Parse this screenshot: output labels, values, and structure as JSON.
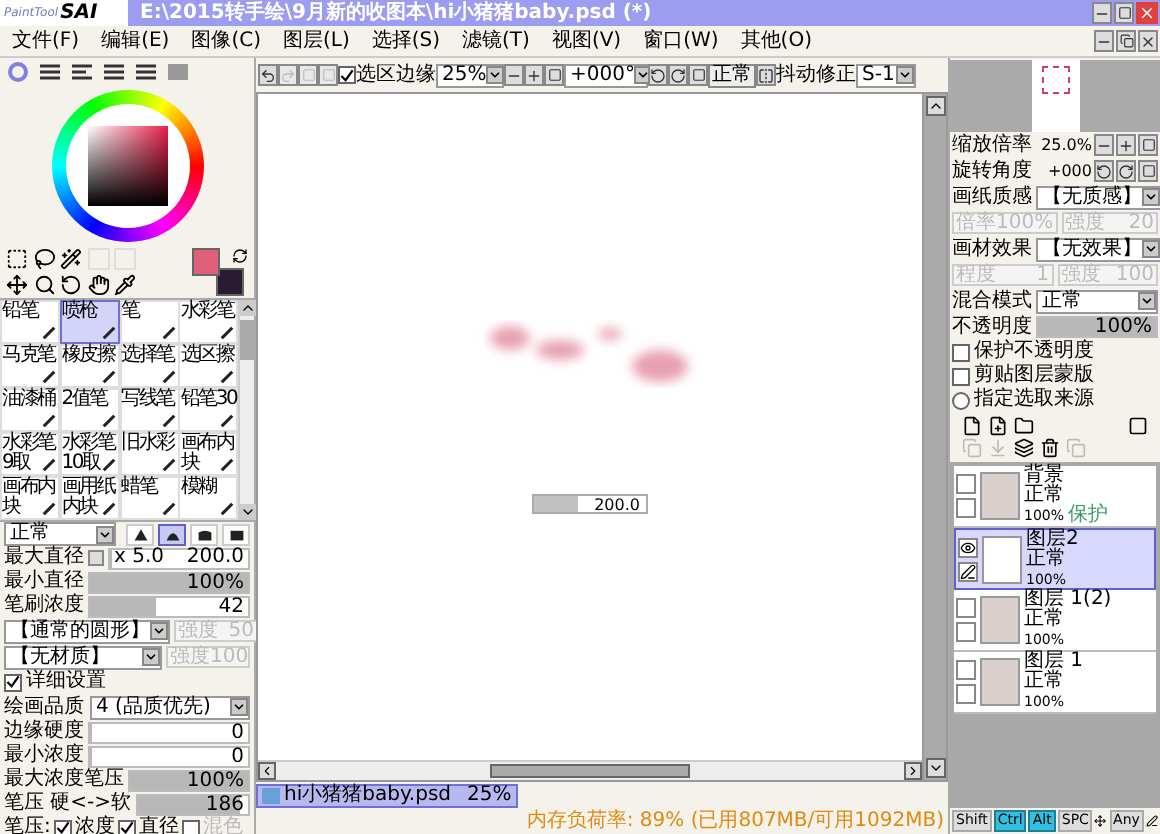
{
  "window": {
    "logo_small": "PaintTool",
    "logo_big": "SAI",
    "title": "E:\\2015转手绘\\9月新的收图本\\hi小猪猪baby.psd (*)"
  },
  "menu": [
    "文件(F)",
    "编辑(E)",
    "图像(C)",
    "图层(L)",
    "选择(S)",
    "滤镜(T)",
    "视图(V)",
    "窗口(W)",
    "其他(O)"
  ],
  "toolbar": {
    "selection_edge": {
      "label": "选区边缘",
      "checked": true
    },
    "zoom": "25%",
    "rotation": "+000°",
    "mode": "正常",
    "stabilizer_label": "抖动修正",
    "stabilizer": "S-1"
  },
  "color_panel": {
    "swatches": [
      {
        "color": "#e0607a"
      },
      {
        "color": "#2a1b35"
      }
    ]
  },
  "tools": [
    {
      "label": "铅笔",
      "selected": false
    },
    {
      "label": "喷枪",
      "selected": true
    },
    {
      "label": "笔",
      "selected": false
    },
    {
      "label": "水彩笔",
      "selected": false
    },
    {
      "label": "马克笔",
      "selected": false
    },
    {
      "label": "橡皮擦",
      "selected": false
    },
    {
      "label": "选择笔",
      "selected": false
    },
    {
      "label": "选区擦",
      "selected": false
    },
    {
      "label": "油漆桶",
      "selected": false
    },
    {
      "label": "2值笔",
      "selected": false
    },
    {
      "label": "写线笔",
      "selected": false
    },
    {
      "label": "铅笔30",
      "selected": false
    },
    {
      "label": "水彩笔9取",
      "selected": false
    },
    {
      "label": "水彩笔10取",
      "selected": false
    },
    {
      "label": "旧水彩",
      "selected": false
    },
    {
      "label": "画布内块",
      "selected": false
    },
    {
      "label": "画布内块",
      "selected": false
    },
    {
      "label": "画用纸内块",
      "selected": false
    },
    {
      "label": "蜡笔",
      "selected": false
    },
    {
      "label": "模糊",
      "selected": false
    }
  ],
  "brush": {
    "blend_mode": "正常",
    "tip_shapes": [
      {
        "selected": false
      },
      {
        "selected": true
      },
      {
        "selected": false
      },
      {
        "selected": false
      }
    ],
    "params": [
      {
        "kind": "size",
        "label": "最大直径",
        "multiplier": "x 5.0",
        "value": "200.0",
        "level": 0.02
      },
      {
        "kind": "slider",
        "label": "最小直径",
        "value": "100%",
        "level": 1
      },
      {
        "kind": "slider",
        "label": "笔刷浓度",
        "value": "42",
        "level": 0.42
      },
      {
        "kind": "texture",
        "value": "【通常的圆形】",
        "side_label": "强度",
        "side_value": "50",
        "disabled": true
      },
      {
        "kind": "texture",
        "value": "【无材质】",
        "side_label": "强度",
        "side_value": "100",
        "disabled": true
      },
      {
        "kind": "checkbox",
        "label": "详细设置",
        "checked": true
      },
      {
        "kind": "dropdown",
        "label": "绘画品质",
        "value": "4 (品质优先)"
      },
      {
        "kind": "slider",
        "label": "边缘硬度",
        "value": "0",
        "level": 0
      },
      {
        "kind": "slider",
        "label": "最小浓度",
        "value": "0",
        "level": 0
      },
      {
        "kind": "slider",
        "label": "最大浓度笔压",
        "value": "100%",
        "level": 1
      },
      {
        "kind": "slider",
        "label": "笔压 硬<->软",
        "value": "186",
        "level": 0.93
      },
      {
        "kind": "checks",
        "label": "笔压:",
        "items": [
          {
            "label": "浓度",
            "checked": true,
            "disabled": false
          },
          {
            "label": "直径",
            "checked": true,
            "disabled": false
          },
          {
            "label": "混色",
            "checked": false,
            "disabled": true
          }
        ]
      }
    ]
  },
  "canvas": {
    "size_popup": {
      "value": "200.0",
      "level": 0.4
    }
  },
  "document_tabs": [
    {
      "name": "hi小猪猪baby.psd",
      "zoom": "25%",
      "selected": true
    }
  ],
  "navigator": {
    "zoom_label": "缩放倍率",
    "zoom": "25.0%",
    "angle_label": "旋转角度",
    "angle": "+000"
  },
  "layer_panel": {
    "effects": [
      {
        "label": "画纸质感",
        "value": "【无质感】",
        "disabled": true,
        "fields": [
          {
            "label": "倍率",
            "value": "100%"
          },
          {
            "label": "强度",
            "value": "20"
          }
        ]
      },
      {
        "label": "画材效果",
        "value": "【无效果】",
        "disabled": true,
        "fields": [
          {
            "label": "程度",
            "value": "1"
          },
          {
            "label": "强度",
            "value": "100"
          }
        ]
      }
    ],
    "blend_label": "混合模式",
    "blend_mode": "正常",
    "opacity": {
      "label": "不透明度",
      "value": "100%",
      "level": 1
    },
    "options": [
      {
        "kind": "checkbox",
        "label": "保护不透明度",
        "checked": false
      },
      {
        "kind": "checkbox",
        "label": "剪贴图层蒙版",
        "checked": false
      },
      {
        "kind": "radio",
        "label": "指定选取来源",
        "checked": false
      }
    ]
  },
  "layers": [
    {
      "name": "背景",
      "mode": "正常",
      "opacity": "100%",
      "tag": "保护",
      "kind": "photo",
      "selected": false,
      "visible": false
    },
    {
      "name": "图层2",
      "mode": "正常",
      "opacity": "100%",
      "kind": "blank",
      "selected": true,
      "visible": true
    },
    {
      "name": "图层 1(2)",
      "mode": "正常",
      "opacity": "100%",
      "kind": "photo",
      "selected": false,
      "visible": false
    },
    {
      "name": "图层 1",
      "mode": "正常",
      "opacity": "100%",
      "kind": "photo",
      "selected": false,
      "visible": false
    }
  ],
  "status_bar": {
    "memory": "内存负荷率: 89% (已用807MB/可用1092MB)",
    "keys": [
      {
        "kind": "key",
        "label": "Shift",
        "on": false
      },
      {
        "kind": "key",
        "label": "Ctrl",
        "on": true
      },
      {
        "kind": "key",
        "label": "Alt",
        "on": true
      },
      {
        "kind": "key",
        "label": "SPC",
        "on": false
      },
      {
        "kind": "move"
      },
      {
        "kind": "key",
        "label": "Any",
        "on": false
      },
      {
        "kind": "pen"
      }
    ]
  }
}
